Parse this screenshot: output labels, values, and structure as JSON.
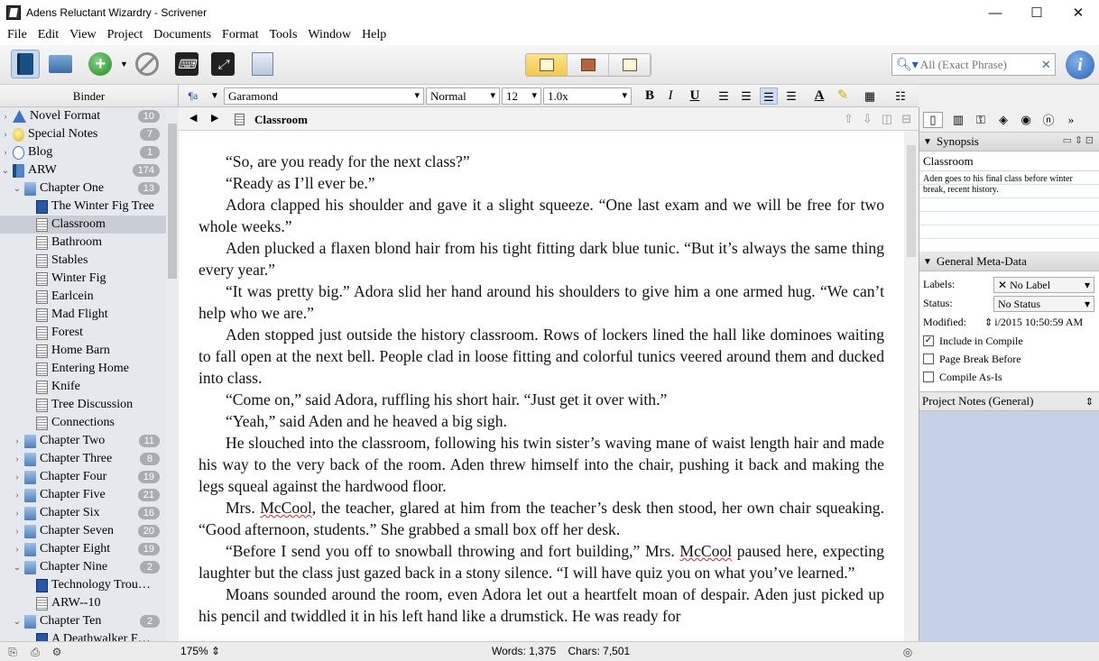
{
  "window": {
    "title": "Adens Reluctant Wizardry - Scrivener",
    "min": "—",
    "max": "☐",
    "close": "✕"
  },
  "menu": [
    "File",
    "Edit",
    "View",
    "Project",
    "Documents",
    "Format",
    "Tools",
    "Window",
    "Help"
  ],
  "search": {
    "placeholder": "All (Exact Phrase)"
  },
  "binder": {
    "header": "Binder",
    "items": [
      {
        "label": "Novel Format",
        "badge": "10",
        "icon": "triangle-icon",
        "arrow": "›",
        "indent": 0
      },
      {
        "label": "Special Notes",
        "badge": "7",
        "icon": "bulb-icon",
        "arrow": "›",
        "indent": 0
      },
      {
        "label": "Blog",
        "badge": "1",
        "icon": "chat-icon",
        "arrow": "›",
        "indent": 0
      },
      {
        "label": "ARW",
        "badge": "174",
        "icon": "book-icon",
        "arrow": "⌄",
        "indent": 0
      },
      {
        "label": "Chapter One",
        "badge": "13",
        "icon": "folder-icon",
        "arrow": "⌄",
        "indent": 1
      },
      {
        "label": "The Winter Fig Tree",
        "badge": "",
        "icon": "doc-blue-icon",
        "arrow": "",
        "indent": 2
      },
      {
        "label": "Classroom",
        "badge": "",
        "icon": "document-icon",
        "arrow": "",
        "indent": 2,
        "selected": true
      },
      {
        "label": "Bathroom",
        "badge": "",
        "icon": "document-icon",
        "arrow": "",
        "indent": 2
      },
      {
        "label": "Stables",
        "badge": "",
        "icon": "document-icon",
        "arrow": "",
        "indent": 2
      },
      {
        "label": "Winter Fig",
        "badge": "",
        "icon": "document-icon",
        "arrow": "",
        "indent": 2
      },
      {
        "label": "Earlcein",
        "badge": "",
        "icon": "document-icon",
        "arrow": "",
        "indent": 2
      },
      {
        "label": "Mad Flight",
        "badge": "",
        "icon": "document-icon",
        "arrow": "",
        "indent": 2
      },
      {
        "label": "Forest",
        "badge": "",
        "icon": "document-icon",
        "arrow": "",
        "indent": 2
      },
      {
        "label": "Home Barn",
        "badge": "",
        "icon": "document-icon",
        "arrow": "",
        "indent": 2
      },
      {
        "label": "Entering Home",
        "badge": "",
        "icon": "document-icon",
        "arrow": "",
        "indent": 2
      },
      {
        "label": "Knife",
        "badge": "",
        "icon": "document-icon",
        "arrow": "",
        "indent": 2
      },
      {
        "label": "Tree Discussion",
        "badge": "",
        "icon": "document-icon",
        "arrow": "",
        "indent": 2
      },
      {
        "label": "Connections",
        "badge": "",
        "icon": "document-icon",
        "arrow": "",
        "indent": 2
      },
      {
        "label": "Chapter Two",
        "badge": "11",
        "icon": "folder-icon",
        "arrow": "›",
        "indent": 1
      },
      {
        "label": "Chapter Three",
        "badge": "8",
        "icon": "folder-icon",
        "arrow": "›",
        "indent": 1
      },
      {
        "label": "Chapter Four",
        "badge": "19",
        "icon": "folder-icon",
        "arrow": "›",
        "indent": 1
      },
      {
        "label": "Chapter Five",
        "badge": "21",
        "icon": "folder-icon",
        "arrow": "›",
        "indent": 1
      },
      {
        "label": "Chapter Six",
        "badge": "16",
        "icon": "folder-icon",
        "arrow": "›",
        "indent": 1
      },
      {
        "label": "Chapter Seven",
        "badge": "20",
        "icon": "folder-icon",
        "arrow": "›",
        "indent": 1
      },
      {
        "label": "Chapter Eight",
        "badge": "19",
        "icon": "folder-icon",
        "arrow": "›",
        "indent": 1
      },
      {
        "label": "Chapter Nine",
        "badge": "2",
        "icon": "folder-icon",
        "arrow": "⌄",
        "indent": 1
      },
      {
        "label": "Technology Trou…",
        "badge": "",
        "icon": "doc-blue-icon",
        "arrow": "",
        "indent": 2
      },
      {
        "label": "ARW--10",
        "badge": "",
        "icon": "document-icon",
        "arrow": "",
        "indent": 2
      },
      {
        "label": "Chapter Ten",
        "badge": "2",
        "icon": "folder-icon",
        "arrow": "⌄",
        "indent": 1
      },
      {
        "label": "A Deathwalker F…",
        "badge": "",
        "icon": "doc-blue-icon",
        "arrow": "",
        "indent": 2
      }
    ]
  },
  "format": {
    "font": "Garamond",
    "style": "Normal",
    "size": "12",
    "spacing": "1.0x"
  },
  "editor": {
    "doc_title": "Classroom",
    "paragraphs": [
      "“So, are you ready for the next class?”",
      "“Ready as I’ll ever be.”",
      "Adora clapped his shoulder and gave it a slight squeeze. “One last exam and we will be free for two whole weeks.”",
      "Aden plucked a flaxen blond hair from his tight fitting dark blue tunic. “But it’s always the same thing every year.”",
      "“It was pretty big.” Adora slid her hand around his shoulders to give him a one armed hug. “We can’t help who we are.”",
      "Aden stopped just outside the history classroom. Rows of lockers lined the hall like dominoes waiting to fall open at the next bell. People clad in loose fitting and colorful tunics veered around them and ducked into class.",
      "“Come on,” said Adora, ruffling his short hair. “Just get it over with.”",
      "“Yeah,” said Aden and he heaved a big sigh.",
      "He slouched into the classroom, following his twin sister’s waving mane of waist length hair and made his way to the very back of the room. Aden threw himself into the chair, pushing it back and making the legs squeal against the hardwood floor."
    ],
    "p_mccool_a": "Mrs. ",
    "p_mccool_name": "McCool",
    "p_mccool_b": ", the teacher, glared at him from the teacher’s desk then stood, her own chair squeaking. “Good afternoon, students.” She grabbed a small box off her desk.",
    "p_before_a": "“Before I send you off to snowball throwing and fort building,” Mrs. ",
    "p_before_name": "McCool",
    "p_before_b": " paused here, expecting laughter but the class just gazed back in a stony silence. “I will have quiz you on what you’ve learned.”",
    "p_last": "Moans sounded around the room, even Adora let out a heartfelt moan of despair. Aden just picked up his pencil and twiddled it in his left hand like a drumstick. He was ready for"
  },
  "status": {
    "zoom": "175%",
    "words": "Words: 1,375",
    "chars": "Chars: 7,501"
  },
  "inspector": {
    "synopsis_head": "Synopsis",
    "synopsis_title": "Classroom",
    "synopsis_text": "Aden goes to his final class before winter break, recent history.",
    "meta_head": "General Meta-Data",
    "labels_key": "Labels:",
    "labels_val": "No Label",
    "status_key": "Status:",
    "status_val": "No Status",
    "modified_key": "Modified:",
    "modified_val": "i/2015 10:50:59 AM",
    "include_compile": "Include in Compile",
    "page_break": "Page Break Before",
    "compile_asis": "Compile As-Is",
    "project_notes": "Project Notes (General)"
  }
}
